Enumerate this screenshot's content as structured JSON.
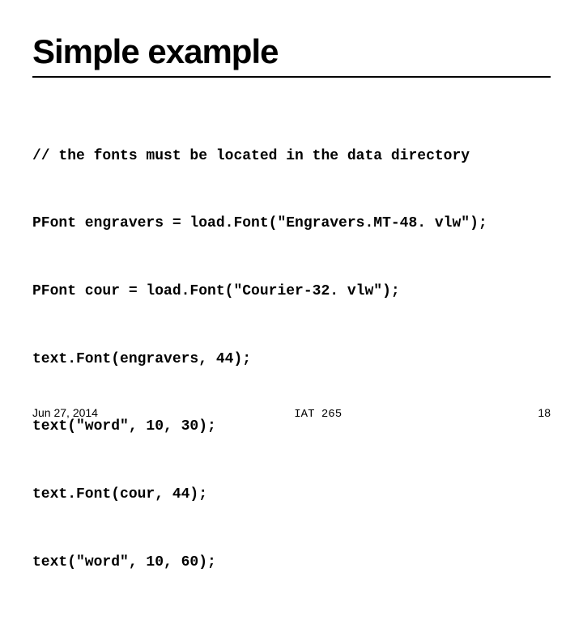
{
  "title": "Simple example",
  "code_lines": [
    "// the fonts must be located in the data directory",
    "PFont engravers = load.Font(\"Engravers.MT-48. vlw\");",
    "PFont cour = load.Font(\"Courier-32. vlw\");",
    "text.Font(engravers, 44);",
    "text(\"word\", 10, 30);",
    "text.Font(cour, 44);",
    "text(\"word\", 10, 60);"
  ],
  "footer": {
    "date": "Jun 27, 2014",
    "course": "IAT 265",
    "page": "18"
  }
}
